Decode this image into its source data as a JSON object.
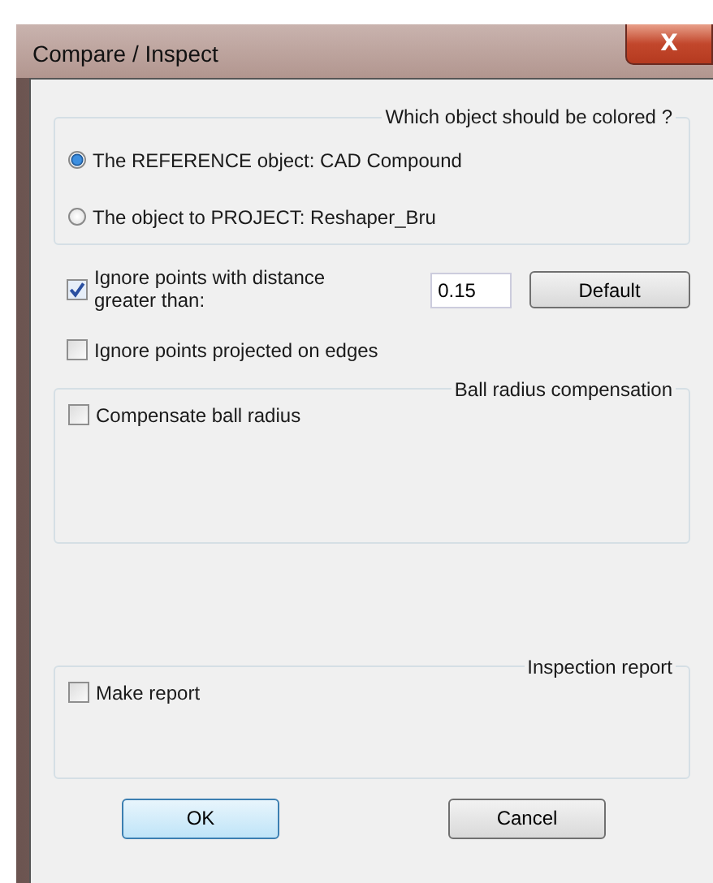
{
  "window": {
    "title": "Compare / Inspect",
    "close": "X"
  },
  "coloring": {
    "legend": "Which object should be colored ?",
    "options": [
      {
        "label": "The REFERENCE object: CAD Compound",
        "selected": true
      },
      {
        "label": "The object to PROJECT: Reshaper_Bru",
        "selected": false
      }
    ]
  },
  "distance": {
    "label": "Ignore points with distance greater than:",
    "checked": true,
    "value": "0.15",
    "button": "Default"
  },
  "edges": {
    "label": "Ignore points projected on edges",
    "checked": false
  },
  "ball": {
    "legend": "Ball radius compensation",
    "label": "Compensate ball radius",
    "checked": false
  },
  "report": {
    "legend": "Inspection report",
    "label": "Make report",
    "checked": false
  },
  "buttons": [
    {
      "label": "OK",
      "kind": "default"
    },
    {
      "label": "Cancel",
      "kind": "normal"
    }
  ]
}
